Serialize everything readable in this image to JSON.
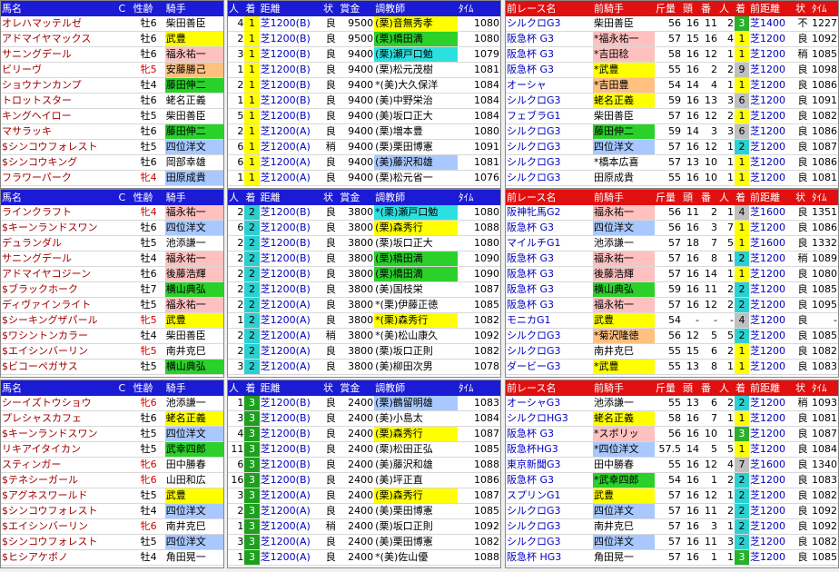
{
  "headers": {
    "horse": [
      "馬名",
      "C",
      "性齢",
      "騎手"
    ],
    "race": [
      "人",
      "着",
      "距離",
      "状",
      "賞金",
      "調教師",
      "ﾀｲﾑ"
    ],
    "prev": [
      "前レース名",
      "前騎手",
      "斤量",
      "頭",
      "番",
      "人",
      "着",
      "前距離",
      "状",
      "ﾀｲﾑ"
    ]
  },
  "blocks": [
    {
      "finish": "1",
      "rows": [
        {
          "name": "オレハマッテルゼ",
          "sex": "牡6",
          "jockey": "柴田善臣",
          "jc": "",
          "pop": "4",
          "dist": "芝1200(B)",
          "cond": "良",
          "prize": "9500",
          "trainer": "(栗)音無秀孝",
          "tc": "cYel",
          "time": "1080",
          "prev_race": "シルクロG3",
          "prev_jockey": "柴田善臣",
          "pjc": "",
          "kin": "56",
          "head": "16",
          "ban": "11",
          "pp": "2",
          "pf": "3",
          "pdist": "芝1400",
          "pcond": "不",
          "ptime": "1227"
        },
        {
          "name": "アドマイヤマックス",
          "sex": "牡6",
          "jockey": "武豊",
          "jc": "cYel",
          "pop": "2",
          "dist": "芝1200(B)",
          "cond": "良",
          "prize": "9500",
          "trainer": "(栗)橋田満",
          "tc": "cGrn",
          "time": "1080",
          "prev_race": "阪急杯 G3",
          "prev_jockey": "*福永祐一",
          "pjc": "cPink",
          "kin": "57",
          "head": "15",
          "ban": "16",
          "pp": "4",
          "pf": "1",
          "pdist": "芝1200",
          "pcond": "良",
          "ptime": "1092"
        },
        {
          "name": "サニングデール",
          "sex": "牡6",
          "jockey": "福永祐一",
          "jc": "cPink",
          "pop": "3",
          "dist": "芝1200(B)",
          "cond": "良",
          "prize": "9400",
          "trainer": "(栗)瀬戸口勉",
          "tc": "cCyan",
          "time": "1079",
          "prev_race": "阪急杯 G3",
          "prev_jockey": "*吉田稔",
          "pjc": "cPink",
          "kin": "58",
          "head": "16",
          "ban": "12",
          "pp": "1",
          "pf": "1",
          "pdist": "芝1200",
          "pcond": "稍",
          "ptime": "1085"
        },
        {
          "name": "ビリーヴ",
          "sex": "牝5",
          "jockey": "安藤勝己",
          "jc": "cOrg",
          "pop": "1",
          "dist": "芝1200(B)",
          "cond": "良",
          "prize": "9400",
          "trainer": "(栗)松元茂樹",
          "tc": "",
          "time": "1081",
          "prev_race": "阪急杯 G3",
          "prev_jockey": "*武豊",
          "pjc": "cYel",
          "kin": "55",
          "head": "16",
          "ban": "2",
          "pp": "2",
          "pf": "9",
          "pdist": "芝1200",
          "pcond": "良",
          "ptime": "1098"
        },
        {
          "name": "ショウナンカンプ",
          "sex": "牡4",
          "jockey": "藤田伸二",
          "jc": "cGrn",
          "pop": "2",
          "dist": "芝1200(B)",
          "cond": "良",
          "prize": "9400",
          "trainer": "*(美)大久保洋",
          "tc": "",
          "time": "1084",
          "prev_race": "オーシャ",
          "prev_jockey": "*吉田豊",
          "pjc": "cOrg",
          "kin": "54",
          "head": "14",
          "ban": "4",
          "pp": "1",
          "pf": "1",
          "pdist": "芝1200",
          "pcond": "良",
          "ptime": "1086"
        },
        {
          "name": "トロットスター",
          "sex": "牡6",
          "jockey": "蛯名正義",
          "jc": "",
          "pop": "1",
          "dist": "芝1200(B)",
          "cond": "良",
          "prize": "9400",
          "trainer": "(美)中野栄治",
          "tc": "",
          "time": "1084",
          "prev_race": "シルクロG3",
          "prev_jockey": "蛯名正義",
          "pjc": "cYel",
          "kin": "59",
          "head": "16",
          "ban": "13",
          "pp": "3",
          "pf": "6",
          "pdist": "芝1200",
          "pcond": "良",
          "ptime": "1091"
        },
        {
          "name": "キングヘイロー",
          "sex": "牡5",
          "jockey": "柴田善臣",
          "jc": "",
          "pop": "5",
          "dist": "芝1200(B)",
          "cond": "良",
          "prize": "9400",
          "trainer": "(美)坂口正大",
          "tc": "",
          "time": "1084",
          "prev_race": "フェブラG1",
          "prev_jockey": "柴田善臣",
          "pjc": "",
          "kin": "57",
          "head": "16",
          "ban": "12",
          "pp": "2",
          "pf": "1",
          "pdist": "芝1200",
          "pcond": "良",
          "ptime": "1082"
        },
        {
          "name": "マサラッキ",
          "sex": "牡6",
          "jockey": "藤田伸二",
          "jc": "cGrn",
          "pop": "2",
          "dist": "芝1200(A)",
          "cond": "良",
          "prize": "9400",
          "trainer": "(栗)増本豊",
          "tc": "",
          "time": "1080",
          "prev_race": "シルクロG3",
          "prev_jockey": "藤田伸二",
          "pjc": "cGrn",
          "kin": "59",
          "head": "14",
          "ban": "3",
          "pp": "3",
          "pf": "6",
          "pdist": "芝1200",
          "pcond": "良",
          "ptime": "1086"
        },
        {
          "name": "$シンコウフォレスト",
          "sex": "牡5",
          "jockey": "四位洋文",
          "jc": "cLb",
          "pop": "6",
          "dist": "芝1200(A)",
          "cond": "稍",
          "prize": "9400",
          "trainer": "(栗)栗田博憲",
          "tc": "",
          "time": "1091",
          "prev_race": "シルクロG3",
          "prev_jockey": "四位洋文",
          "pjc": "cLb",
          "kin": "57",
          "head": "16",
          "ban": "12",
          "pp": "1",
          "pf": "2",
          "pdist": "芝1200",
          "pcond": "良",
          "ptime": "1087"
        },
        {
          "name": "$シンコウキング",
          "sex": "牡6",
          "jockey": "岡部幸雄",
          "jc": "",
          "pop": "6",
          "dist": "芝1200(A)",
          "cond": "良",
          "prize": "9400",
          "trainer": "(美)藤沢和雄",
          "tc": "cLb",
          "time": "1081",
          "prev_race": "シルクロG3",
          "prev_jockey": "*橋本広喜",
          "pjc": "",
          "kin": "57",
          "head": "13",
          "ban": "10",
          "pp": "1",
          "pf": "1",
          "pdist": "芝1200",
          "pcond": "良",
          "ptime": "1086"
        },
        {
          "name": "フラワーパーク",
          "sex": "牝4",
          "jockey": "田原成貴",
          "jc": "cLb",
          "pop": "1",
          "dist": "芝1200(A)",
          "cond": "良",
          "prize": "9400",
          "trainer": "(栗)松元省一",
          "tc": "",
          "time": "1076",
          "prev_race": "シルクロG3",
          "prev_jockey": "田原成貴",
          "pjc": "",
          "kin": "55",
          "head": "16",
          "ban": "10",
          "pp": "1",
          "pf": "1",
          "pdist": "芝1200",
          "pcond": "良",
          "ptime": "1081"
        }
      ]
    },
    {
      "finish": "2",
      "rows": [
        {
          "name": "ラインクラフト",
          "sex": "牝4",
          "jockey": "福永祐一",
          "jc": "cPink",
          "pop": "2",
          "dist": "芝1200(B)",
          "cond": "良",
          "prize": "3800",
          "trainer": "*(栗)瀬戸口勉",
          "tc": "cCyan",
          "time": "1080",
          "prev_race": "阪神牝馬G2",
          "prev_jockey": "福永祐一",
          "pjc": "cPink",
          "kin": "56",
          "head": "11",
          "ban": "2",
          "pp": "1",
          "pf": "4",
          "pdist": "芝1600",
          "pcond": "良",
          "ptime": "1351"
        },
        {
          "name": "$キーンランドスワン",
          "sex": "牡6",
          "jockey": "四位洋文",
          "jc": "cLb",
          "pop": "6",
          "dist": "芝1200(B)",
          "cond": "良",
          "prize": "3800",
          "trainer": "(栗)森秀行",
          "tc": "cYel",
          "time": "1088",
          "prev_race": "阪急杯 G3",
          "prev_jockey": "四位洋文",
          "pjc": "cLb",
          "kin": "56",
          "head": "16",
          "ban": "3",
          "pp": "7",
          "pf": "1",
          "pdist": "芝1200",
          "pcond": "良",
          "ptime": "1086"
        },
        {
          "name": "デュランダル",
          "sex": "牡5",
          "jockey": "池添謙一",
          "jc": "",
          "pop": "2",
          "dist": "芝1200(B)",
          "cond": "良",
          "prize": "3800",
          "trainer": "(栗)坂口正大",
          "tc": "",
          "time": "1080",
          "prev_race": "マイルチG1",
          "prev_jockey": "池添謙一",
          "pjc": "",
          "kin": "57",
          "head": "18",
          "ban": "7",
          "pp": "5",
          "pf": "1",
          "pdist": "芝1600",
          "pcond": "良",
          "ptime": "1332"
        },
        {
          "name": "サニングデール",
          "sex": "牡4",
          "jockey": "福永祐一",
          "jc": "cPink",
          "pop": "2",
          "dist": "芝1200(B)",
          "cond": "良",
          "prize": "3800",
          "trainer": "(栗)橋田満",
          "tc": "cGrn",
          "time": "1090",
          "prev_race": "阪急杯 G3",
          "prev_jockey": "福永祐一",
          "pjc": "cPink",
          "kin": "57",
          "head": "16",
          "ban": "8",
          "pp": "1",
          "pf": "2",
          "pdist": "芝1200",
          "pcond": "稍",
          "ptime": "1089"
        },
        {
          "name": "アドマイヤコジーン",
          "sex": "牡6",
          "jockey": "後藤浩輝",
          "jc": "cPink",
          "pop": "2",
          "dist": "芝1200(B)",
          "cond": "良",
          "prize": "3800",
          "trainer": "(栗)橋田満",
          "tc": "cGrn",
          "time": "1090",
          "prev_race": "阪急杯 G3",
          "prev_jockey": "後藤浩輝",
          "pjc": "cPink",
          "kin": "57",
          "head": "16",
          "ban": "14",
          "pp": "1",
          "pf": "1",
          "pdist": "芝1200",
          "pcond": "良",
          "ptime": "1080"
        },
        {
          "name": "$ブラックホーク",
          "sex": "牡7",
          "jockey": "横山典弘",
          "jc": "cGrn",
          "pop": "2",
          "dist": "芝1200(B)",
          "cond": "良",
          "prize": "3800",
          "trainer": "(美)国枝栄",
          "tc": "",
          "time": "1087",
          "prev_race": "阪急杯 G3",
          "prev_jockey": "横山典弘",
          "pjc": "cGrn",
          "kin": "59",
          "head": "16",
          "ban": "11",
          "pp": "2",
          "pf": "2",
          "pdist": "芝1200",
          "pcond": "良",
          "ptime": "1085"
        },
        {
          "name": "ディヴァインライト",
          "sex": "牡5",
          "jockey": "福永祐一",
          "jc": "cPink",
          "pop": "2",
          "dist": "芝1200(A)",
          "cond": "良",
          "prize": "3800",
          "trainer": "*(栗)伊藤正徳",
          "tc": "",
          "time": "1085",
          "prev_race": "阪急杯 G3",
          "prev_jockey": "福永祐一",
          "pjc": "cPink",
          "kin": "57",
          "head": "16",
          "ban": "12",
          "pp": "2",
          "pf": "2",
          "pdist": "芝1200",
          "pcond": "良",
          "ptime": "1095"
        },
        {
          "name": "$シーキングザパール",
          "sex": "牝5",
          "jockey": "武豊",
          "jc": "cYel",
          "pop": "1",
          "dist": "芝1200(A)",
          "cond": "良",
          "prize": "3800",
          "trainer": "*(栗)森秀行",
          "tc": "cYel",
          "time": "1082",
          "prev_race": "モニカG1",
          "prev_jockey": "武豊",
          "pjc": "cYel",
          "kin": "54",
          "head": "-",
          "ban": "-",
          "pp": "-",
          "pf": "4",
          "pdist": "芝1200",
          "pcond": "良",
          "ptime": "-"
        },
        {
          "name": "$ワシントンカラー",
          "sex": "牡4",
          "jockey": "柴田善臣",
          "jc": "",
          "pop": "2",
          "dist": "芝1200(A)",
          "cond": "稍",
          "prize": "3800",
          "trainer": "*(美)松山康久",
          "tc": "",
          "time": "1092",
          "prev_race": "シルクロG3",
          "prev_jockey": "*菊沢隆徳",
          "pjc": "cOrg",
          "kin": "56",
          "head": "12",
          "ban": "5",
          "pp": "5",
          "pf": "2",
          "pdist": "芝1200",
          "pcond": "良",
          "ptime": "1085"
        },
        {
          "name": "$エイシンバーリン",
          "sex": "牝5",
          "jockey": "南井克巳",
          "jc": "",
          "pop": "2",
          "dist": "芝1200(A)",
          "cond": "良",
          "prize": "3800",
          "trainer": "(栗)坂口正則",
          "tc": "",
          "time": "1082",
          "prev_race": "シルクロG3",
          "prev_jockey": "南井克巳",
          "pjc": "",
          "kin": "55",
          "head": "15",
          "ban": "6",
          "pp": "2",
          "pf": "1",
          "pdist": "芝1200",
          "pcond": "良",
          "ptime": "1082"
        },
        {
          "name": "$ビコーペガサス",
          "sex": "牡5",
          "jockey": "横山典弘",
          "jc": "cGrn",
          "pop": "3",
          "dist": "芝1200(A)",
          "cond": "良",
          "prize": "3800",
          "trainer": "(美)柳田次男",
          "tc": "",
          "time": "1078",
          "prev_race": "ダービーG3",
          "prev_jockey": "*武豊",
          "pjc": "cYel",
          "kin": "55",
          "head": "13",
          "ban": "8",
          "pp": "1",
          "pf": "1",
          "pdist": "芝1200",
          "pcond": "良",
          "ptime": "1083"
        }
      ]
    },
    {
      "finish": "3",
      "rows": [
        {
          "name": "シーイズトウショウ",
          "sex": "牝6",
          "jockey": "池添謙一",
          "jc": "",
          "pop": "1",
          "dist": "芝1200(B)",
          "cond": "良",
          "prize": "2400",
          "trainer": "(栗)鶴留明雄",
          "tc": "cLb",
          "time": "1083",
          "prev_race": "オーシャG3",
          "prev_jockey": "池添謙一",
          "pjc": "",
          "kin": "55",
          "head": "13",
          "ban": "6",
          "pp": "2",
          "pf": "2",
          "pdist": "芝1200",
          "pcond": "稍",
          "ptime": "1093"
        },
        {
          "name": "プレシャスカフェ",
          "sex": "牡6",
          "jockey": "蛯名正義",
          "jc": "cYel",
          "pop": "3",
          "dist": "芝1200(B)",
          "cond": "良",
          "prize": "2400",
          "trainer": "(美)小島太",
          "tc": "",
          "time": "1084",
          "prev_race": "シルクロHG3",
          "prev_jockey": "蛯名正義",
          "pjc": "cYel",
          "kin": "58",
          "head": "16",
          "ban": "7",
          "pp": "1",
          "pf": "1",
          "pdist": "芝1200",
          "pcond": "良",
          "ptime": "1081"
        },
        {
          "name": "$キーンランドスワン",
          "sex": "牡5",
          "jockey": "四位洋文",
          "jc": "cLb",
          "pop": "4",
          "dist": "芝1200(B)",
          "cond": "良",
          "prize": "2400",
          "trainer": "(栗)森秀行",
          "tc": "cYel",
          "time": "1087",
          "prev_race": "阪急杯 G3",
          "prev_jockey": "*スボリッ",
          "pjc": "cPink",
          "kin": "56",
          "head": "16",
          "ban": "10",
          "pp": "1",
          "pf": "3",
          "pdist": "芝1200",
          "pcond": "良",
          "ptime": "1087"
        },
        {
          "name": "リキアイタイカン",
          "sex": "牡5",
          "jockey": "武幸四郎",
          "jc": "cGrn",
          "pop": "11",
          "dist": "芝1200(B)",
          "cond": "良",
          "prize": "2400",
          "trainer": "(栗)松田正弘",
          "tc": "",
          "time": "1085",
          "prev_race": "阪急杯HG3",
          "prev_jockey": "*四位洋文",
          "pjc": "cLb",
          "kin": "57.5",
          "head": "14",
          "ban": "5",
          "pp": "5",
          "pf": "1",
          "pdist": "芝1200",
          "pcond": "良",
          "ptime": "1084"
        },
        {
          "name": "スティンガー",
          "sex": "牝6",
          "jockey": "田中勝春",
          "jc": "",
          "pop": "6",
          "dist": "芝1200(B)",
          "cond": "良",
          "prize": "2400",
          "trainer": "(美)藤沢和雄",
          "tc": "",
          "time": "1088",
          "prev_race": "東京新聞G3",
          "prev_jockey": "田中勝春",
          "pjc": "",
          "kin": "55",
          "head": "16",
          "ban": "12",
          "pp": "4",
          "pf": "7",
          "pdist": "芝1600",
          "pcond": "良",
          "ptime": "1340"
        },
        {
          "name": "$テネシーガール",
          "sex": "牝6",
          "jockey": "山田和広",
          "jc": "",
          "pop": "16",
          "dist": "芝1200(B)",
          "cond": "良",
          "prize": "2400",
          "trainer": "(美)坪正直",
          "tc": "",
          "time": "1086",
          "prev_race": "阪急杯 G3",
          "prev_jockey": "*武幸四郎",
          "pjc": "cGrn",
          "kin": "54",
          "head": "16",
          "ban": "1",
          "pp": "2",
          "pf": "2",
          "pdist": "芝1200",
          "pcond": "良",
          "ptime": "1083"
        },
        {
          "name": "$アグネスワールド",
          "sex": "牡5",
          "jockey": "武豊",
          "jc": "cYel",
          "pop": "3",
          "dist": "芝1200(A)",
          "cond": "良",
          "prize": "2400",
          "trainer": "(栗)森秀行",
          "tc": "cYel",
          "time": "1087",
          "prev_race": "スプリンG1",
          "prev_jockey": "武豊",
          "pjc": "cYel",
          "kin": "57",
          "head": "16",
          "ban": "12",
          "pp": "1",
          "pf": "2",
          "pdist": "芝1200",
          "pcond": "良",
          "ptime": "1082"
        },
        {
          "name": "$シンコウフォレスト",
          "sex": "牡4",
          "jockey": "四位洋文",
          "jc": "cLb",
          "pop": "2",
          "dist": "芝1200(A)",
          "cond": "良",
          "prize": "2400",
          "trainer": "(美)栗田博憲",
          "tc": "",
          "time": "1085",
          "prev_race": "シルクロG3",
          "prev_jockey": "四位洋文",
          "pjc": "cLb",
          "kin": "57",
          "head": "16",
          "ban": "11",
          "pp": "2",
          "pf": "2",
          "pdist": "芝1200",
          "pcond": "良",
          "ptime": "1092"
        },
        {
          "name": "$エイシンバーリン",
          "sex": "牝6",
          "jockey": "南井克巳",
          "jc": "",
          "pop": "1",
          "dist": "芝1200(A)",
          "cond": "稍",
          "prize": "2400",
          "trainer": "(栗)坂口正則",
          "tc": "",
          "time": "1092",
          "prev_race": "シルクロG3",
          "prev_jockey": "南井克巳",
          "pjc": "",
          "kin": "57",
          "head": "16",
          "ban": "3",
          "pp": "1",
          "pf": "2",
          "pdist": "芝1200",
          "pcond": "良",
          "ptime": "1092"
        },
        {
          "name": "$シンコウフォレスト",
          "sex": "牡5",
          "jockey": "四位洋文",
          "jc": "cLb",
          "pop": "3",
          "dist": "芝1200(A)",
          "cond": "良",
          "prize": "2400",
          "trainer": "(美)栗田博憲",
          "tc": "",
          "time": "1082",
          "prev_race": "シルクロG3",
          "prev_jockey": "四位洋文",
          "pjc": "cLb",
          "kin": "57",
          "head": "16",
          "ban": "11",
          "pp": "3",
          "pf": "2",
          "pdist": "芝1200",
          "pcond": "良",
          "ptime": "1082"
        },
        {
          "name": "$ヒシアケボノ",
          "sex": "牡4",
          "jockey": "角田晃一",
          "jc": "",
          "pop": "1",
          "dist": "芝1200(A)",
          "cond": "良",
          "prize": "2400",
          "trainer": "*(美)佐山優",
          "tc": "",
          "time": "1088",
          "prev_race": "阪急杯 HG3",
          "prev_jockey": "角田晃一",
          "pjc": "",
          "kin": "57",
          "head": "16",
          "ban": "1",
          "pp": "1",
          "pf": "3",
          "pdist": "芝1200",
          "pcond": "良",
          "ptime": "1085"
        }
      ]
    }
  ]
}
